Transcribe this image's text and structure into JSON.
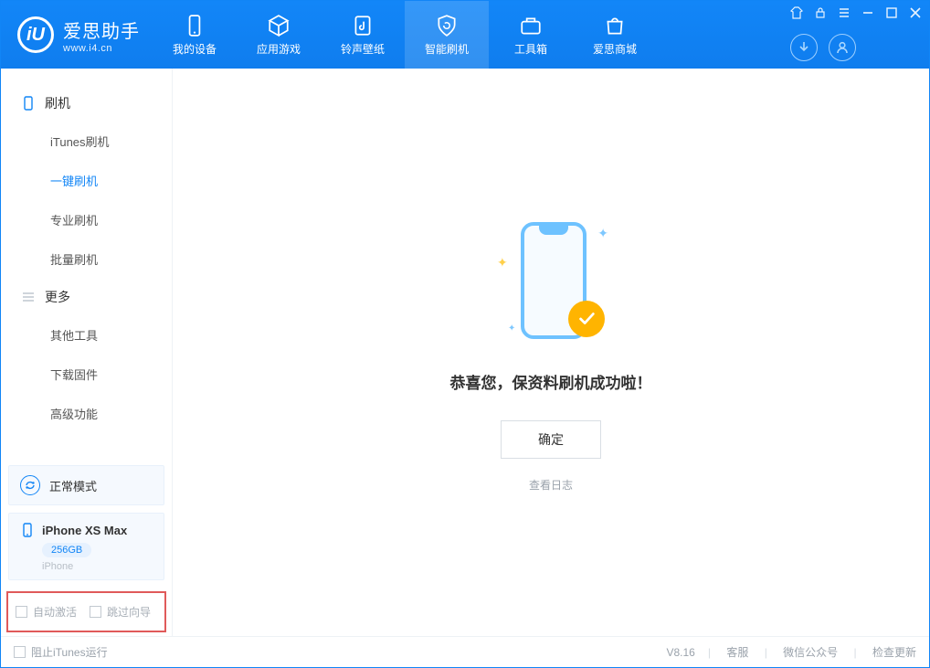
{
  "brand": {
    "cn": "爱思助手",
    "url": "www.i4.cn",
    "mark": "iU"
  },
  "tabs": {
    "device": "我的设备",
    "apps": "应用游戏",
    "ring": "铃声壁纸",
    "flash": "智能刷机",
    "tools": "工具箱",
    "store": "爱思商城"
  },
  "sidebar": {
    "flash_heading": "刷机",
    "items": {
      "itunes": "iTunes刷机",
      "oneclick": "一键刷机",
      "pro": "专业刷机",
      "batch": "批量刷机"
    },
    "more_heading": "更多",
    "more": {
      "other_tools": "其他工具",
      "download_fw": "下载固件",
      "advanced": "高级功能"
    },
    "status_mode": "正常模式",
    "device": {
      "name": "iPhone XS Max",
      "storage": "256GB",
      "type": "iPhone"
    },
    "checkboxes": {
      "auto_activate": "自动激活",
      "skip_guide": "跳过向导"
    }
  },
  "main": {
    "success": "恭喜您，保资料刷机成功啦！",
    "ok": "确定",
    "view_log": "查看日志"
  },
  "footer": {
    "block_itunes": "阻止iTunes运行",
    "version": "V8.16",
    "support": "客服",
    "wechat": "微信公众号",
    "update": "检查更新"
  }
}
